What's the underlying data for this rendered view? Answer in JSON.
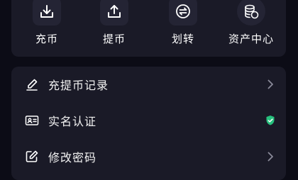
{
  "actions": [
    {
      "label": "充币",
      "icon": "download-icon"
    },
    {
      "label": "提币",
      "icon": "upload-icon"
    },
    {
      "label": "划转",
      "icon": "transfer-icon"
    },
    {
      "label": "资产中心",
      "icon": "coins-icon"
    }
  ],
  "menu": [
    {
      "label": "充提币记录",
      "icon": "pen-icon",
      "trail": "chevron-right-icon"
    },
    {
      "label": "实名认证",
      "icon": "id-card-icon",
      "trail": "verified-check-icon"
    },
    {
      "label": "修改密码",
      "icon": "edit-icon",
      "trail": "chevron-right-icon"
    }
  ],
  "colors": {
    "background": "#0c0c16",
    "card": "#1a1a27",
    "icon_box": "#242434",
    "verified": "#27c07d",
    "chevron": "#8a8a99"
  }
}
